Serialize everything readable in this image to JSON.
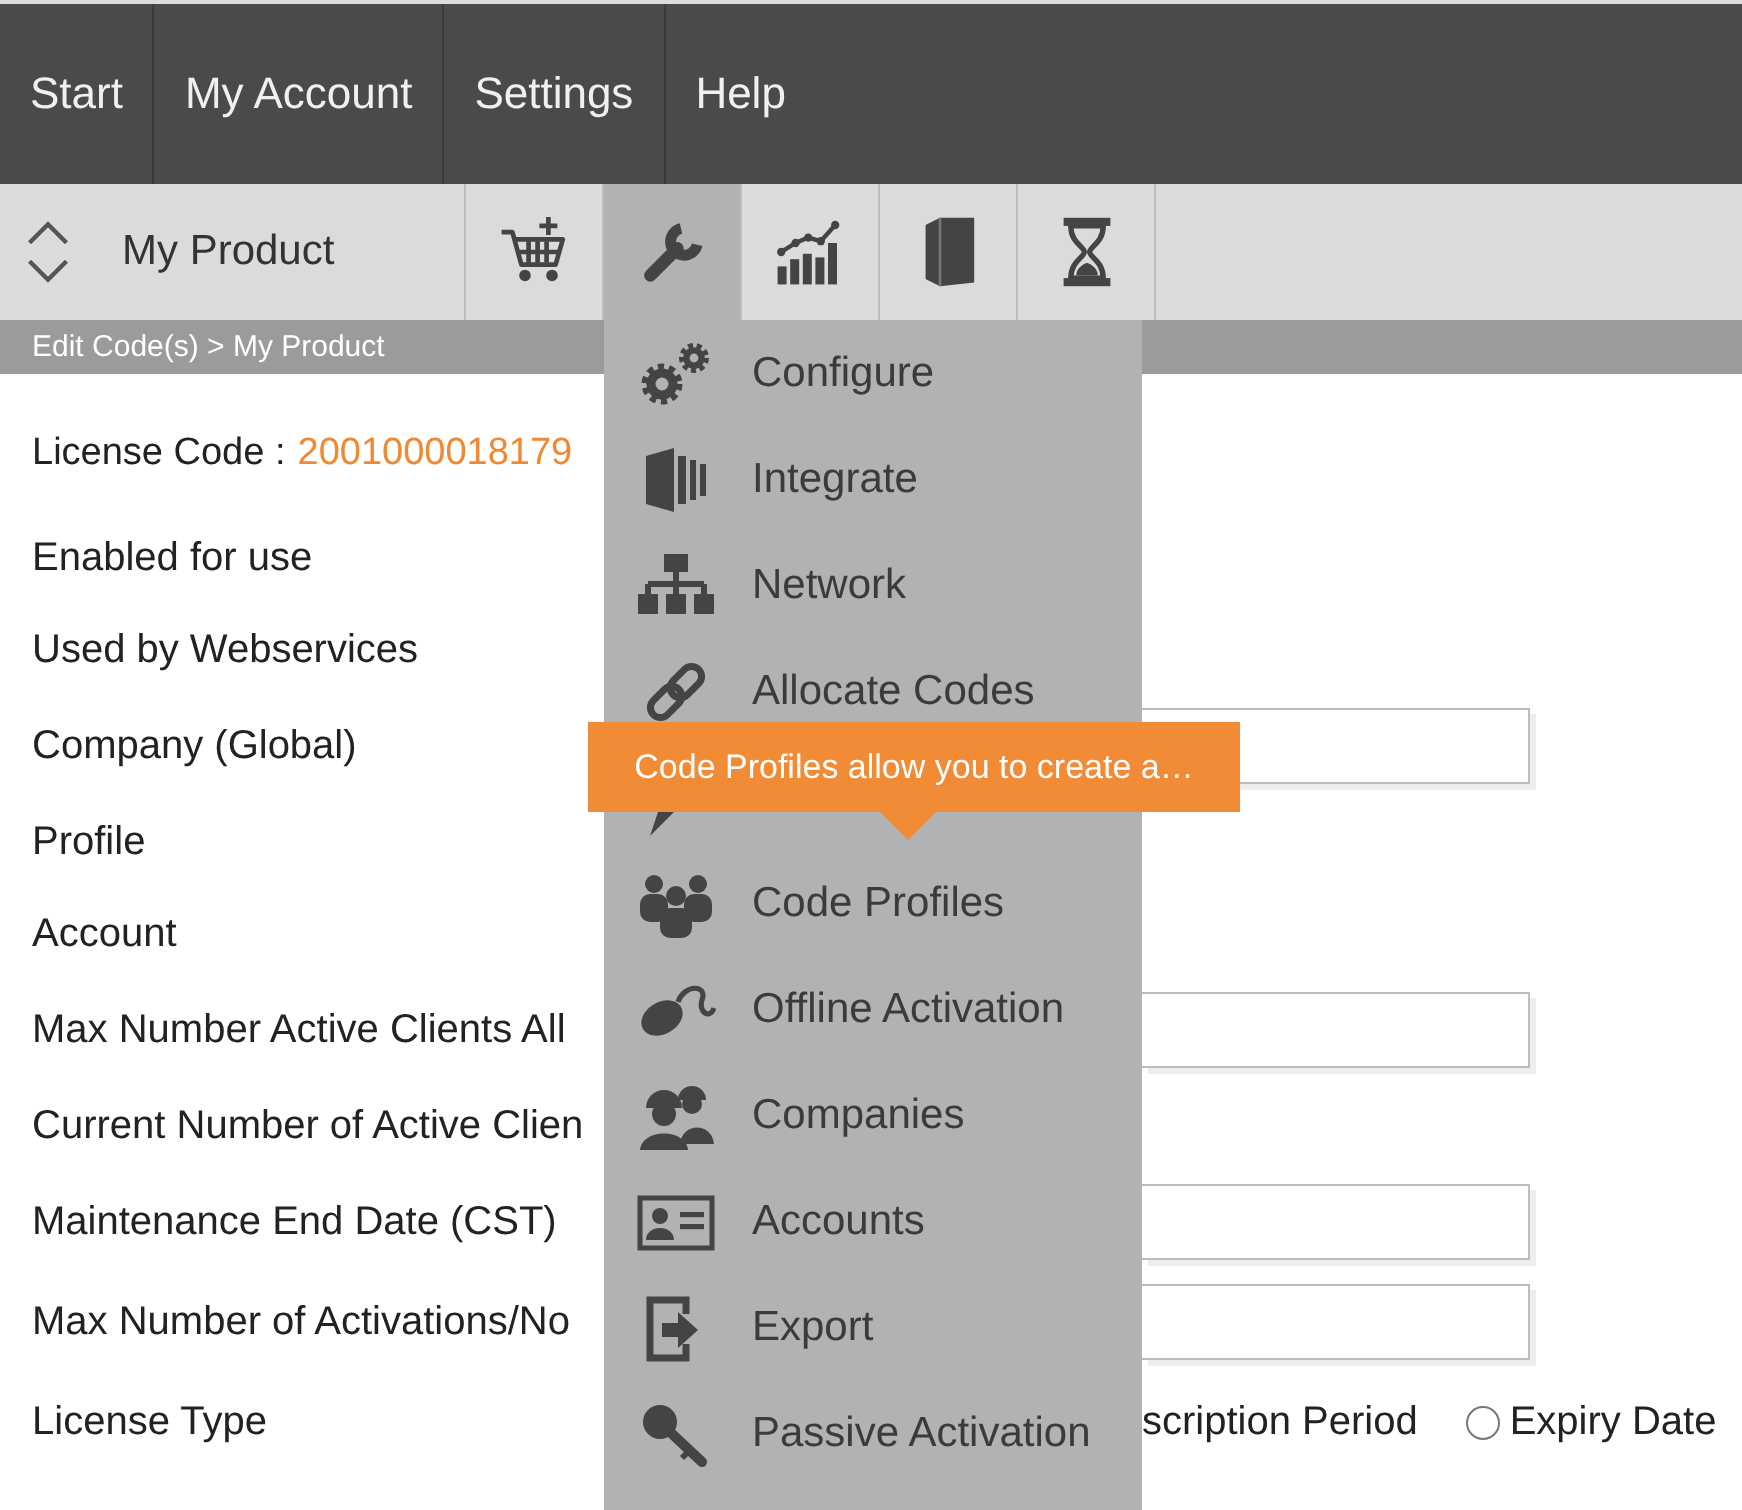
{
  "top_nav": {
    "items": [
      {
        "label": "Start"
      },
      {
        "label": "My Account"
      },
      {
        "label": "Settings"
      },
      {
        "label": "Help"
      }
    ]
  },
  "toolbar": {
    "product": "My Product",
    "buttons": [
      {
        "selected": false
      },
      {
        "selected": true
      },
      {
        "selected": false
      },
      {
        "selected": false
      },
      {
        "selected": false
      }
    ]
  },
  "breadcrumb": "Edit Code(s) > My Product",
  "form": {
    "rows": [
      {
        "kind": "code",
        "label": "License Code :",
        "value": "2001000018179"
      },
      {
        "kind": "label",
        "label": "Enabled for use"
      },
      {
        "kind": "label",
        "label": "Used by Webservices"
      },
      {
        "kind": "field",
        "label": "Company (Global)"
      },
      {
        "kind": "label",
        "label": "Profile"
      },
      {
        "kind": "label",
        "label": "Account"
      },
      {
        "kind": "field",
        "label": "Max Number Active Clients All"
      },
      {
        "kind": "label",
        "label": "Current Number of Active Clien"
      },
      {
        "kind": "field",
        "label": "Maintenance End Date (CST)"
      },
      {
        "kind": "field",
        "label": "Max Number of Activations/No"
      },
      {
        "kind": "radio",
        "label": "License Type",
        "trailing_text": "scription Period",
        "options": [
          {
            "label": "Expiry Date",
            "selected": false
          }
        ]
      }
    ]
  },
  "tools_menu": {
    "items": [
      {
        "kind": "item",
        "label": "Configure"
      },
      {
        "kind": "item",
        "label": "Integrate"
      },
      {
        "kind": "item",
        "label": "Network"
      },
      {
        "kind": "item",
        "label": "Allocate Codes"
      },
      {
        "kind": "covered"
      },
      {
        "kind": "item",
        "label": "Code Profiles"
      },
      {
        "kind": "item",
        "label": "Offline Activation"
      },
      {
        "kind": "item",
        "label": "Companies"
      },
      {
        "kind": "item",
        "label": "Accounts"
      },
      {
        "kind": "item",
        "label": "Export"
      },
      {
        "kind": "item",
        "label": "Passive Activation"
      }
    ]
  },
  "tooltip": {
    "text": "Code Profiles allow you to create a…"
  }
}
